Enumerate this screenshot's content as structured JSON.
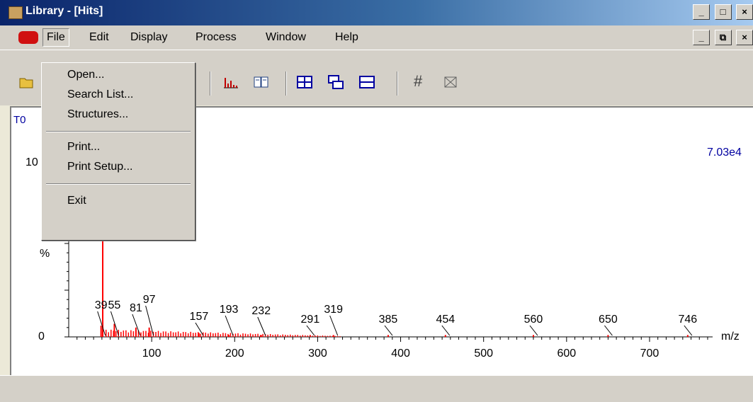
{
  "window": {
    "title": "Library - [Hits]",
    "controls": [
      "_",
      "□",
      "×"
    ]
  },
  "mdi_controls": [
    "_",
    "⧉",
    "×"
  ],
  "menubar": {
    "items": [
      "File",
      "Edit",
      "Display",
      "Process",
      "Window",
      "Help"
    ]
  },
  "file_menu": {
    "items": [
      "Open...",
      "Search List...",
      "Structures...",
      "Print...",
      "Print Setup...",
      "Exit"
    ]
  },
  "toolbar": {
    "hash": "#"
  },
  "plot": {
    "corner_label": "T0",
    "max_intensity": "7.03e4",
    "y_top_label": "10",
    "y_percent_label": "%",
    "y_zero_label": "0",
    "x_unit": "m/z"
  },
  "chart_data": {
    "type": "bar",
    "xlabel": "m/z",
    "xlim": [
      0,
      800
    ],
    "ylim": [
      0,
      100
    ],
    "x_ticks": [
      100,
      200,
      300,
      400,
      500,
      600,
      700
    ],
    "peak_labels": [
      39,
      55,
      81,
      97,
      157,
      193,
      232,
      291,
      319,
      385,
      454,
      560,
      650,
      746
    ],
    "peaks": [
      {
        "mz": 39,
        "intensity": 6
      },
      {
        "mz": 41,
        "intensity": 100
      },
      {
        "mz": 55,
        "intensity": 7
      },
      {
        "mz": 81,
        "intensity": 5
      },
      {
        "mz": 97,
        "intensity": 5
      },
      {
        "mz": 157,
        "intensity": 2
      },
      {
        "mz": 193,
        "intensity": 1
      },
      {
        "mz": 232,
        "intensity": 1
      },
      {
        "mz": 291,
        "intensity": 1
      },
      {
        "mz": 319,
        "intensity": 1
      },
      {
        "mz": 385,
        "intensity": 1
      },
      {
        "mz": 454,
        "intensity": 1
      },
      {
        "mz": 560,
        "intensity": 1
      },
      {
        "mz": 650,
        "intensity": 1
      },
      {
        "mz": 746,
        "intensity": 1
      }
    ],
    "colors": {
      "peaks": "#ff0000",
      "labels": "#0000a0"
    }
  }
}
